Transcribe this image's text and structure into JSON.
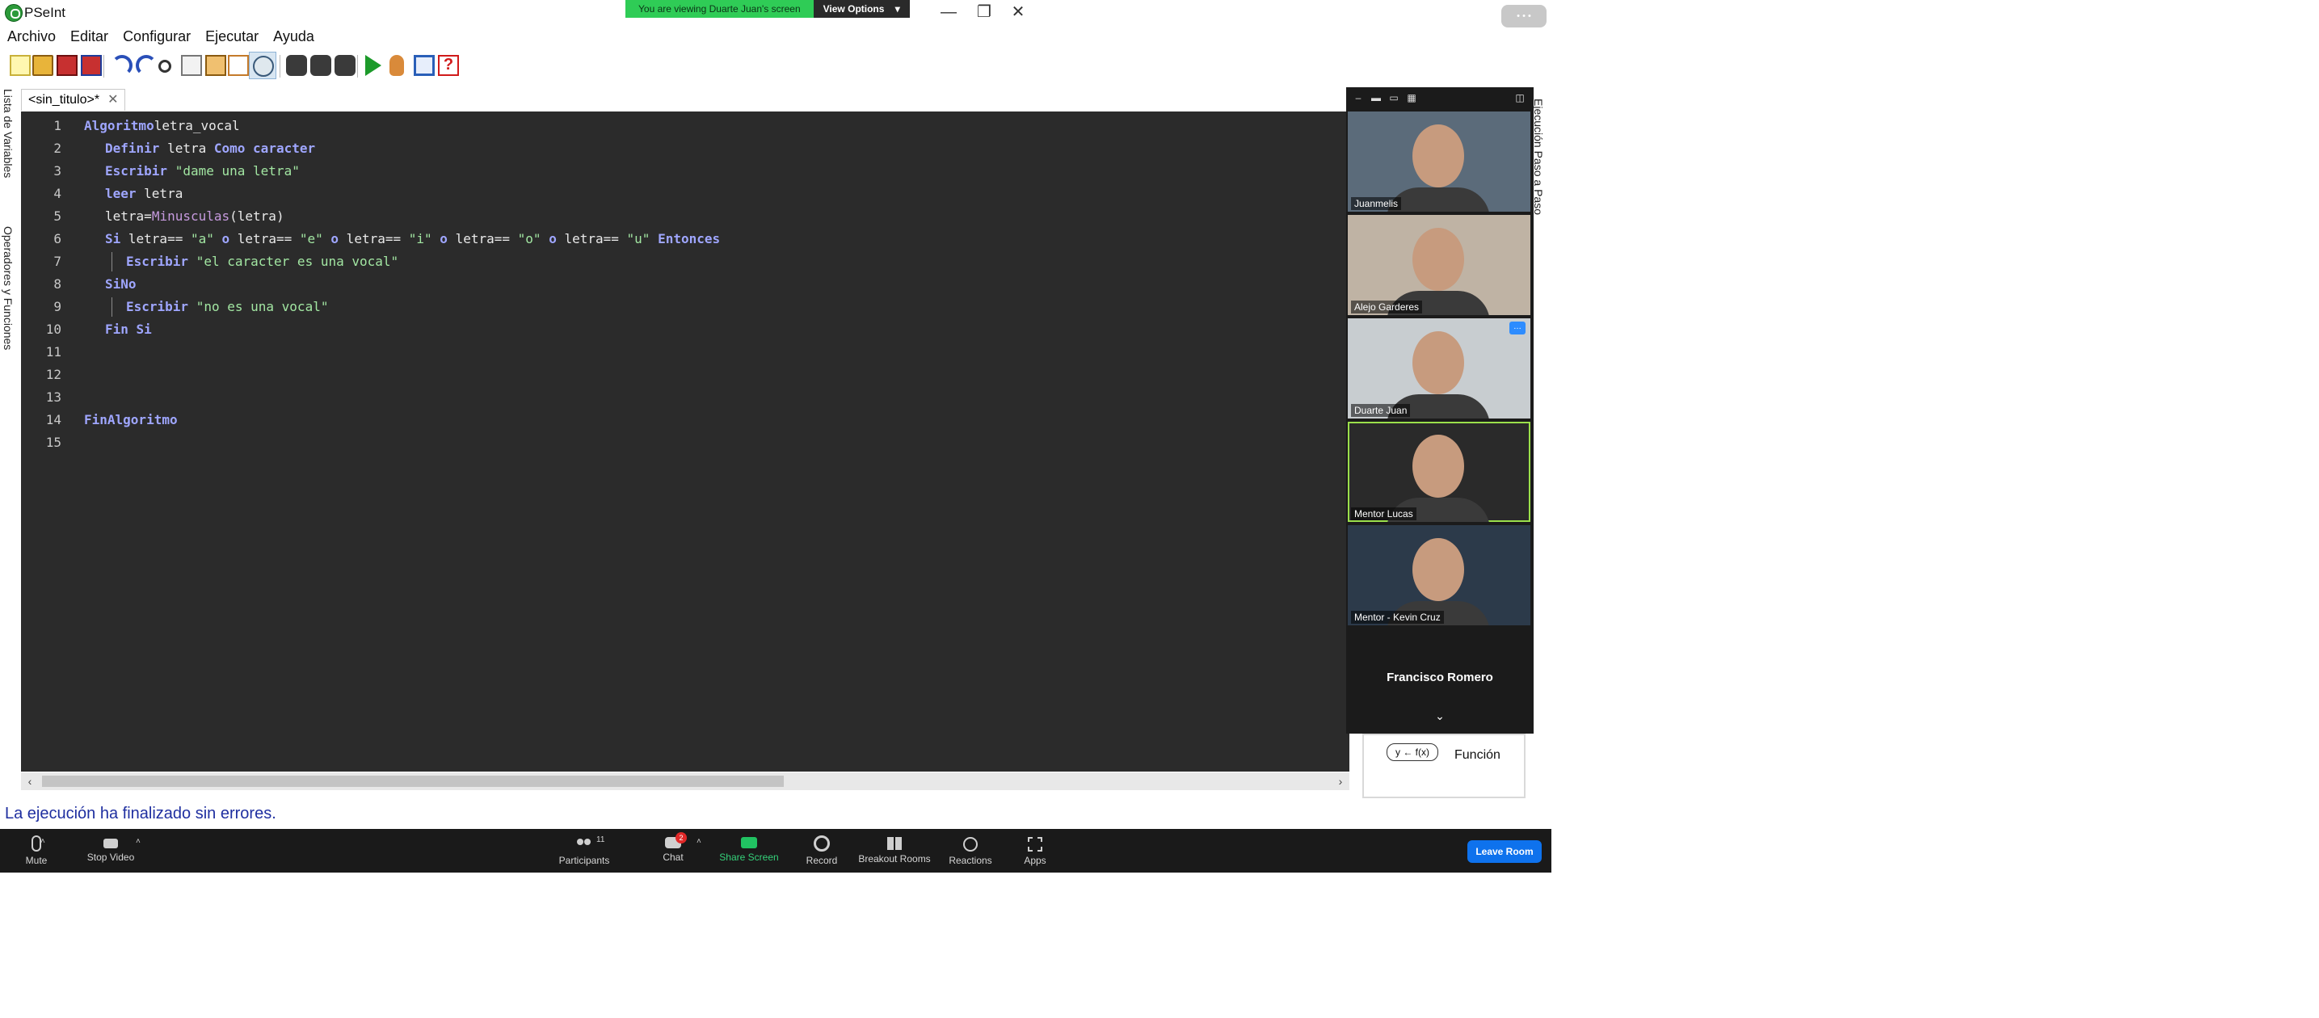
{
  "window": {
    "title": "PSeInt",
    "minimize": "—",
    "restore": "❐",
    "close": "✕"
  },
  "zoom_banner": {
    "text": "You are viewing Duarte Juan's screen",
    "button": "View Options"
  },
  "menubar": [
    "Archivo",
    "Editar",
    "Configurar",
    "Ejecutar",
    "Ayuda"
  ],
  "toolbar": [
    "new-file",
    "open-folder",
    "save",
    "save-as",
    "undo",
    "redo",
    "cut",
    "copy",
    "paste",
    "indent",
    "step-debug",
    "find",
    "find-next",
    "replace",
    "run",
    "step-by-step",
    "draw-flowchart",
    "help"
  ],
  "side_tabs": {
    "variables": "Lista de Variables",
    "operators": "Operadores y Funciones"
  },
  "editor": {
    "tab_label": "<sin_titulo>*",
    "tab_close": "✕",
    "colors": {
      "background": "#2b2b2b",
      "keyword": "#9fa6ff",
      "string": "#a2e6a2",
      "function": "#c69ade",
      "text": "#e9e9e9"
    },
    "lines": [
      {
        "n": "1",
        "indent": 0,
        "guide": false,
        "tokens": [
          [
            "kw",
            "Algoritmo"
          ],
          [
            "",
            "letra_vocal"
          ]
        ]
      },
      {
        "n": "2",
        "indent": 1,
        "guide": false,
        "tokens": [
          [
            "kw",
            "Definir"
          ],
          [
            "",
            " letra "
          ],
          [
            "kw",
            "Como"
          ],
          [
            "",
            " "
          ],
          [
            "kw",
            "caracter"
          ]
        ]
      },
      {
        "n": "3",
        "indent": 1,
        "guide": false,
        "tokens": [
          [
            "kw",
            "Escribir"
          ],
          [
            "",
            " "
          ],
          [
            "str",
            "\"dame una letra\""
          ]
        ]
      },
      {
        "n": "4",
        "indent": 1,
        "guide": false,
        "tokens": [
          [
            "kw",
            "leer"
          ],
          [
            "",
            " letra"
          ]
        ]
      },
      {
        "n": "5",
        "indent": 1,
        "guide": false,
        "tokens": [
          [
            "",
            "letra"
          ],
          [
            "",
            "="
          ],
          [
            "fn",
            "Minusculas"
          ],
          [
            "",
            "(letra)"
          ]
        ]
      },
      {
        "n": "6",
        "indent": 1,
        "guide": false,
        "tokens": [
          [
            "kw",
            "Si"
          ],
          [
            "",
            " letra== "
          ],
          [
            "str",
            "\"a\""
          ],
          [
            "",
            " "
          ],
          [
            "kw",
            "o"
          ],
          [
            "",
            " letra== "
          ],
          [
            "str",
            "\"e\""
          ],
          [
            "",
            " "
          ],
          [
            "kw",
            "o"
          ],
          [
            "",
            " letra== "
          ],
          [
            "str",
            "\"i\""
          ],
          [
            "",
            " "
          ],
          [
            "kw",
            "o"
          ],
          [
            "",
            " letra== "
          ],
          [
            "str",
            "\"o\""
          ],
          [
            "",
            " "
          ],
          [
            "kw",
            "o"
          ],
          [
            "",
            " letra== "
          ],
          [
            "str",
            "\"u\""
          ],
          [
            "",
            " "
          ],
          [
            "kw",
            "Entonces"
          ]
        ]
      },
      {
        "n": "7",
        "indent": 2,
        "guide": true,
        "tokens": [
          [
            "kw",
            "Escribir"
          ],
          [
            "",
            " "
          ],
          [
            "str",
            "\"el caracter es una vocal\""
          ]
        ]
      },
      {
        "n": "8",
        "indent": 1,
        "guide": false,
        "tokens": [
          [
            "kw",
            "SiNo"
          ]
        ]
      },
      {
        "n": "9",
        "indent": 2,
        "guide": true,
        "tokens": [
          [
            "kw",
            "Escribir"
          ],
          [
            "",
            " "
          ],
          [
            "str",
            "\"no es una vocal\""
          ]
        ]
      },
      {
        "n": "10",
        "indent": 1,
        "guide": false,
        "tokens": [
          [
            "kw",
            "Fin Si"
          ]
        ]
      },
      {
        "n": "11",
        "indent": 0,
        "guide": false,
        "tokens": []
      },
      {
        "n": "12",
        "indent": 0,
        "guide": false,
        "tokens": []
      },
      {
        "n": "13",
        "indent": 0,
        "guide": false,
        "tokens": []
      },
      {
        "n": "14",
        "indent": 0,
        "guide": false,
        "tokens": [
          [
            "kw",
            "FinAlgoritmo"
          ]
        ]
      },
      {
        "n": "15",
        "indent": 0,
        "guide": false,
        "tokens": []
      }
    ]
  },
  "status": "La ejecución ha finalizado sin errores.",
  "right_panel": {
    "func_icon": "y ← f(x)",
    "func_label": "Función",
    "side_tab": "Ejecución Paso a Paso"
  },
  "video_strip": {
    "tiles": [
      {
        "name": "Juanmelis",
        "speaker": false,
        "more": false,
        "bg": "#5b6b7a"
      },
      {
        "name": "Alejo Garderes",
        "speaker": false,
        "more": false,
        "bg": "#bfb3a4"
      },
      {
        "name": "Duarte Juan",
        "speaker": false,
        "more": true,
        "bg": "#c8cdd0"
      },
      {
        "name": "Mentor Lucas",
        "speaker": true,
        "more": false,
        "bg": "#2a2a2a"
      },
      {
        "name": "Mentor - Kevin Cruz",
        "speaker": false,
        "more": false,
        "bg": "#2c3a4a"
      }
    ],
    "more_label": "…",
    "no_video_name": "Francisco Romero",
    "expand": "⌄"
  },
  "zoom_bar": {
    "mute": "Mute",
    "stop_video": "Stop Video",
    "participants": "Participants",
    "participants_count": "11",
    "chat": "Chat",
    "chat_badge": "2",
    "share": "Share Screen",
    "record": "Record",
    "breakout": "Breakout Rooms",
    "reactions": "Reactions",
    "apps": "Apps",
    "leave": "Leave Room",
    "caret": "˄"
  }
}
